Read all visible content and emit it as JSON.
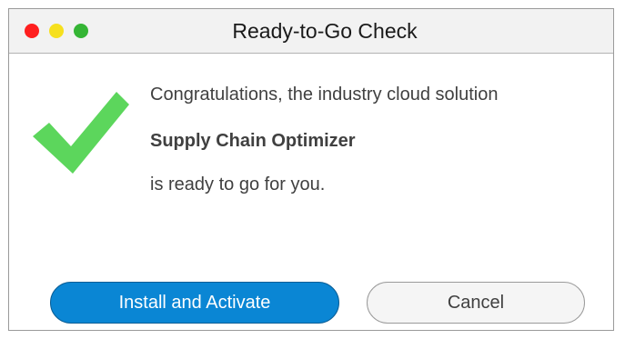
{
  "window": {
    "title": "Ready-to-Go Check",
    "controls": {
      "close_color": "#ff1f1f",
      "minimize_color": "#f6e01e",
      "maximize_color": "#35b535"
    }
  },
  "content": {
    "icon": "checkmark-icon",
    "icon_color": "#5cd65c",
    "line1": "Congratulations, the industry cloud solution",
    "product_name": "Supply Chain Optimizer",
    "line3": "is ready to go for you."
  },
  "buttons": {
    "primary_label": "Install and Activate",
    "primary_color": "#0a86d4",
    "secondary_label": "Cancel"
  }
}
